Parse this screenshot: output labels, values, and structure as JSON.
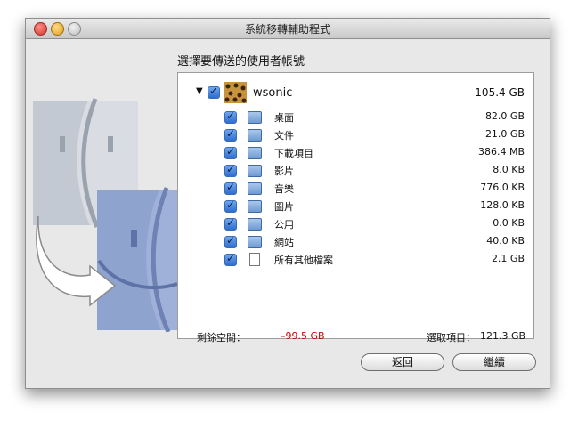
{
  "window": {
    "title": "系統移轉輔助程式"
  },
  "heading": "選擇要傳送的使用者帳號",
  "user": {
    "name": "wsonic",
    "size": "105.4 GB"
  },
  "items": [
    {
      "label": "桌面",
      "size": "82.0 GB",
      "icon": "desktop-folder-icon"
    },
    {
      "label": "文件",
      "size": "21.0 GB",
      "icon": "documents-folder-icon"
    },
    {
      "label": "下載項目",
      "size": "386.4 MB",
      "icon": "downloads-folder-icon"
    },
    {
      "label": "影片",
      "size": "8.0 KB",
      "icon": "movies-folder-icon"
    },
    {
      "label": "音樂",
      "size": "776.0 KB",
      "icon": "music-folder-icon"
    },
    {
      "label": "圖片",
      "size": "128.0 KB",
      "icon": "pictures-folder-icon"
    },
    {
      "label": "公用",
      "size": "0.0 KB",
      "icon": "public-folder-icon"
    },
    {
      "label": "網站",
      "size": "40.0 KB",
      "icon": "sites-folder-icon"
    },
    {
      "label": "所有其他檔案",
      "size": "2.1 GB",
      "icon": "document-icon"
    }
  ],
  "footer": {
    "free_space_label": "剩餘空間：",
    "free_space_value": "–99.5 GB",
    "selected_label": "選取項目：",
    "selected_value": "121.3 GB"
  },
  "buttons": {
    "back": "返回",
    "continue": "繼續"
  },
  "colors": {
    "negative": "#d00000",
    "checkbox": "#2f6dd0"
  }
}
